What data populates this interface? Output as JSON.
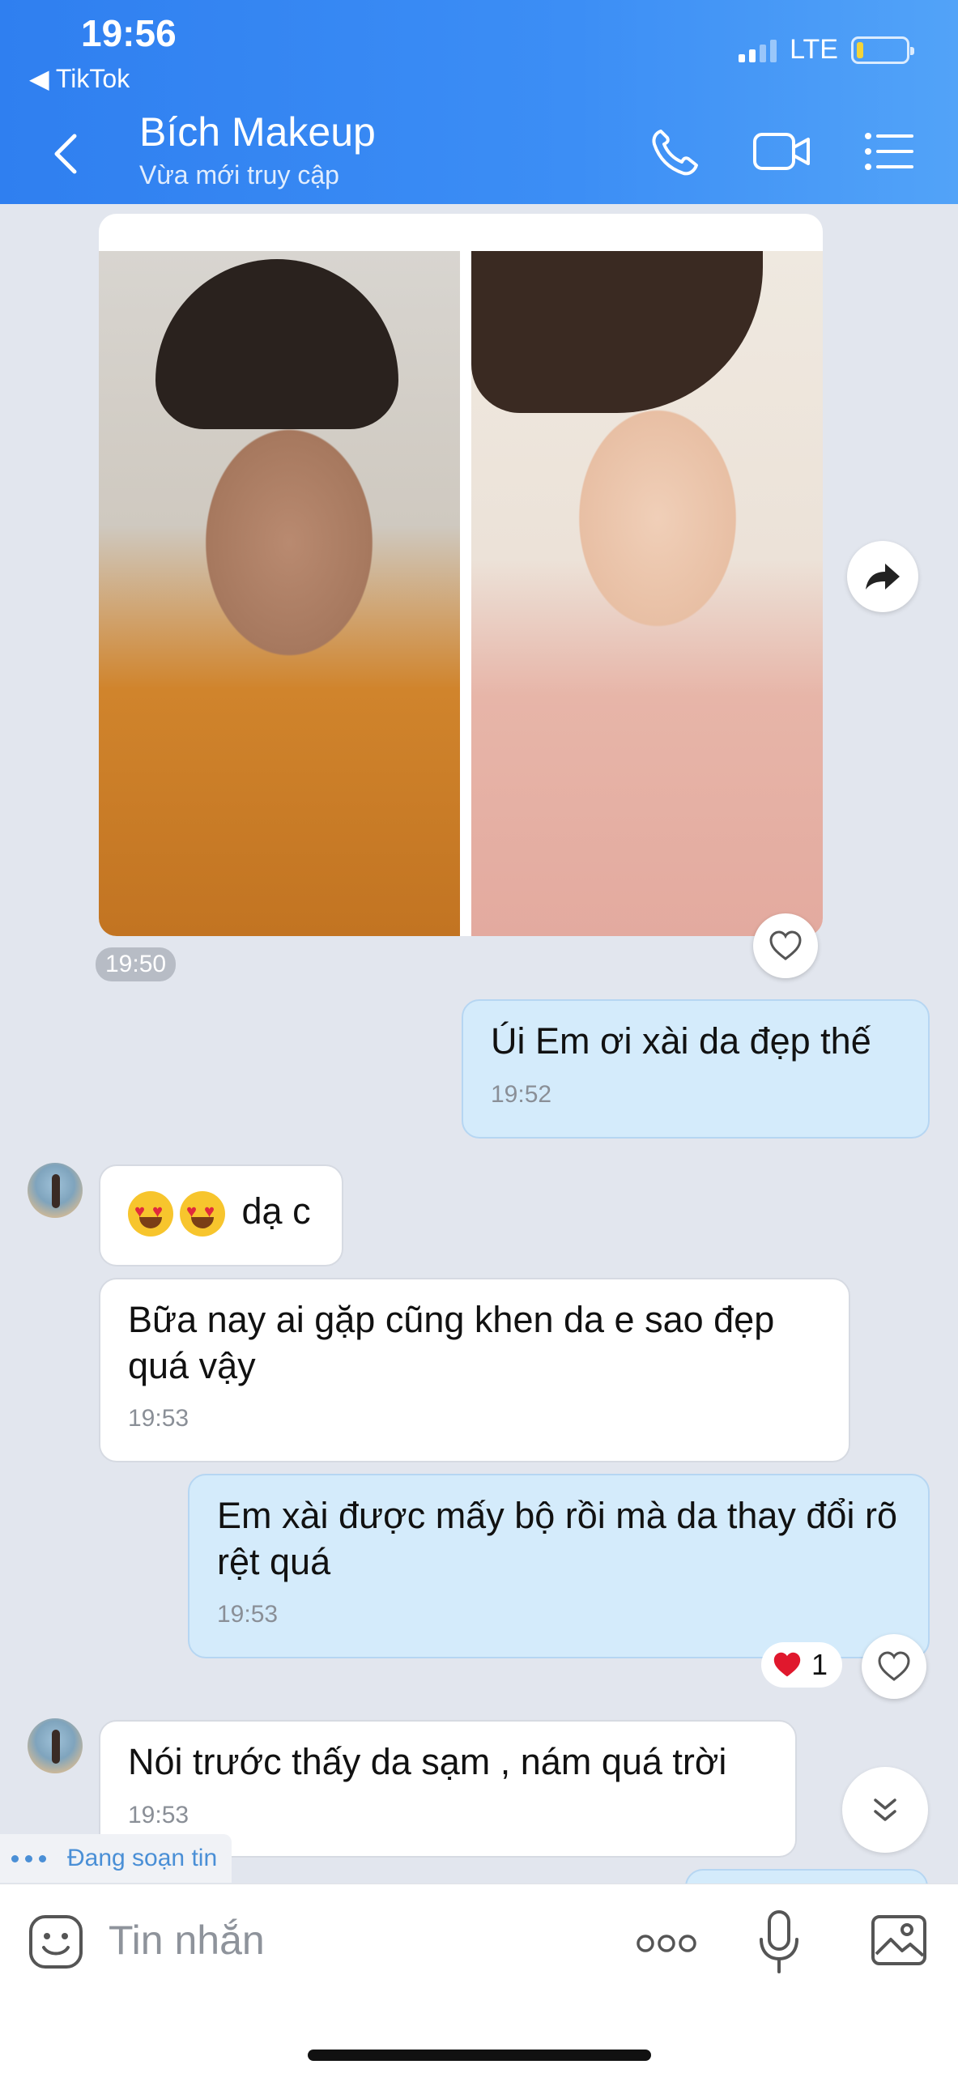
{
  "status_bar": {
    "time": "19:56",
    "back_app": "TikTok",
    "network": "LTE"
  },
  "header": {
    "name": "Bích Makeup",
    "status": "Vừa mới truy cập"
  },
  "messages": [
    {
      "time": "19:50"
    },
    {
      "text": "Úi Em ơi xài  da đẹp thế",
      "time": "19:52"
    },
    {
      "text": "dạ c"
    },
    {
      "text": "Bữa nay ai gặp cũng khen da e sao đẹp quá vậy",
      "time": "19:53"
    },
    {
      "text": "Em xài được mấy bộ rồi mà da thay đổi rõ rệt quá",
      "time": "19:53",
      "reaction_count": "1"
    },
    {
      "text": "Nói trước thấy da sạm , nám quá trời",
      "time": "19:53"
    }
  ],
  "typing_indicator": "Đang soạn tin",
  "input": {
    "placeholder": "Tin nhắn"
  },
  "colors": {
    "header": "#3c8ef5",
    "outgoing_bubble": "#d4ebfb",
    "incoming_bubble": "#ffffff",
    "background": "#e2e6ee"
  }
}
